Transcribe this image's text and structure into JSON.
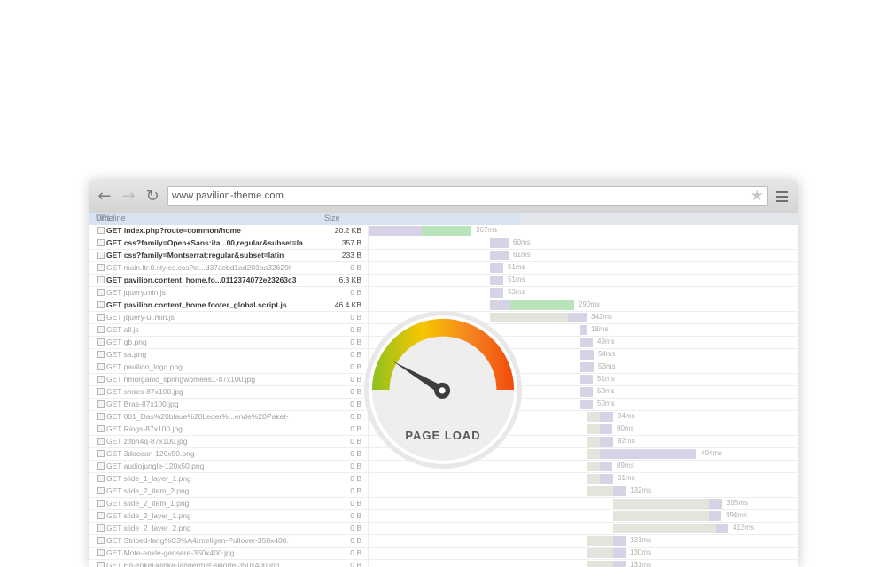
{
  "browser": {
    "url": "www.pavilion-theme.com",
    "back_icon": "back-arrow-icon",
    "forward_icon": "forward-arrow-icon",
    "reload_icon": "reload-icon",
    "bookmark_icon": "star-icon",
    "menu_icon": "hamburger-menu-icon"
  },
  "columns": {
    "url": "URL",
    "size": "Size",
    "timeline": "Timeline"
  },
  "colors": {
    "wait": "#d7d3e6",
    "receive": "#b9e3b9",
    "blocked": "#e4e3dc"
  },
  "requests": [
    {
      "url": "GET index.php?route=common/home",
      "size": "20.2 KB",
      "bold": true,
      "time": "367ms",
      "segs": [
        [
          0,
          60,
          "wait"
        ],
        [
          60,
          116,
          "receive"
        ]
      ]
    },
    {
      "url": "GET css?family=Open+Sans:ita...00,regular&subset=la",
      "size": "357 B",
      "bold": true,
      "time": "60ms",
      "segs": [
        [
          137,
          158,
          "wait"
        ]
      ]
    },
    {
      "url": "GET css?family=Montserrat:regular&subset=latin",
      "size": "233 B",
      "bold": true,
      "time": "61ms",
      "segs": [
        [
          137,
          158,
          "wait"
        ]
      ]
    },
    {
      "url": "GET main.ltr.0.styles.css?id...d37acbd1ad203aa32629l",
      "size": "0 B",
      "bold": false,
      "time": "51ms",
      "segs": [
        [
          137,
          152,
          "wait"
        ]
      ]
    },
    {
      "url": "GET pavilion.content_home.fo...0112374072e23263c3",
      "size": "6.3 KB",
      "bold": true,
      "time": "51ms",
      "segs": [
        [
          137,
          152,
          "wait"
        ]
      ]
    },
    {
      "url": "GET jquery.min.js",
      "size": "0 B",
      "bold": false,
      "time": "53ms",
      "segs": [
        [
          137,
          152,
          "wait"
        ]
      ]
    },
    {
      "url": "GET pavilion.content_home.footer_global.script.js",
      "size": "46.4 KB",
      "bold": true,
      "time": "290ms",
      "segs": [
        [
          137,
          160,
          "wait"
        ],
        [
          160,
          232,
          "receive"
        ]
      ]
    },
    {
      "url": "GET jquery-ui.min.js",
      "size": "0 B",
      "bold": false,
      "time": "342ms",
      "segs": [
        [
          137,
          225,
          "blocked"
        ],
        [
          225,
          246,
          "wait"
        ]
      ]
    },
    {
      "url": "GET all.js",
      "size": "0 B",
      "bold": false,
      "time": "18ms",
      "segs": [
        [
          239,
          246,
          "wait"
        ]
      ]
    },
    {
      "url": "GET gb.png",
      "size": "0 B",
      "bold": false,
      "time": "49ms",
      "segs": [
        [
          239,
          253,
          "wait"
        ]
      ]
    },
    {
      "url": "GET sa.png",
      "size": "0 B",
      "bold": false,
      "time": "54ms",
      "segs": [
        [
          239,
          254,
          "wait"
        ]
      ]
    },
    {
      "url": "GET pavilion_logo.png",
      "size": "0 B",
      "bold": false,
      "time": "53ms",
      "segs": [
        [
          239,
          254,
          "wait"
        ]
      ]
    },
    {
      "url": "GET hmorganic_springwomens1-87x100.jpg",
      "size": "0 B",
      "bold": false,
      "time": "51ms",
      "segs": [
        [
          239,
          253,
          "wait"
        ]
      ]
    },
    {
      "url": "GET shoes-87x100.jpg",
      "size": "0 B",
      "bold": false,
      "time": "50ms",
      "segs": [
        [
          239,
          253,
          "wait"
        ]
      ]
    },
    {
      "url": "GET Bras-87x100.jpg",
      "size": "0 B",
      "bold": false,
      "time": "50ms",
      "segs": [
        [
          239,
          253,
          "wait"
        ]
      ]
    },
    {
      "url": "GET 001_Das%20blaue%20Leder%...ende%20Paket-",
      "size": "0 B",
      "bold": false,
      "time": "94ms",
      "segs": [
        [
          246,
          261,
          "blocked"
        ],
        [
          261,
          276,
          "wait"
        ]
      ]
    },
    {
      "url": "GET Rings-87x100.jpg",
      "size": "0 B",
      "bold": false,
      "time": "90ms",
      "segs": [
        [
          246,
          261,
          "blocked"
        ],
        [
          261,
          275,
          "wait"
        ]
      ]
    },
    {
      "url": "GET zjfbh4q-87x100.jpg",
      "size": "0 B",
      "bold": false,
      "time": "92ms",
      "segs": [
        [
          246,
          261,
          "blocked"
        ],
        [
          261,
          276,
          "wait"
        ]
      ]
    },
    {
      "url": "GET 3docean-120x50.png",
      "size": "0 B",
      "bold": false,
      "time": "404ms",
      "segs": [
        [
          246,
          261,
          "blocked"
        ],
        [
          261,
          370,
          "wait"
        ]
      ]
    },
    {
      "url": "GET audiojungle-120x50.png",
      "size": "0 B",
      "bold": false,
      "time": "89ms",
      "segs": [
        [
          246,
          261,
          "blocked"
        ],
        [
          261,
          275,
          "wait"
        ]
      ]
    },
    {
      "url": "GET slide_1_layer_1.png",
      "size": "0 B",
      "bold": false,
      "time": "91ms",
      "segs": [
        [
          246,
          261,
          "blocked"
        ],
        [
          261,
          276,
          "wait"
        ]
      ]
    },
    {
      "url": "GET slide_2_item_2.png",
      "size": "0 B",
      "bold": false,
      "time": "132ms",
      "segs": [
        [
          246,
          276,
          "blocked"
        ],
        [
          276,
          290,
          "wait"
        ]
      ]
    },
    {
      "url": "GET slide_2_item_1.png",
      "size": "0 B",
      "bold": false,
      "time": "395ms",
      "segs": [
        [
          276,
          384,
          "blocked"
        ],
        [
          384,
          399,
          "wait"
        ]
      ]
    },
    {
      "url": "GET slide_2_layer_1.png",
      "size": "0 B",
      "bold": false,
      "time": "394ms",
      "segs": [
        [
          276,
          384,
          "blocked"
        ],
        [
          384,
          398,
          "wait"
        ]
      ]
    },
    {
      "url": "GET slide_2_layer_2.png",
      "size": "0 B",
      "bold": false,
      "time": "412ms",
      "segs": [
        [
          276,
          392,
          "blocked"
        ],
        [
          392,
          406,
          "wait"
        ]
      ]
    },
    {
      "url": "GET Striped-lang%C3%A4rmeligen-Pullover-350x400.",
      "size": "0 B",
      "bold": false,
      "time": "131ms",
      "segs": [
        [
          246,
          276,
          "blocked"
        ],
        [
          276,
          290,
          "wait"
        ]
      ]
    },
    {
      "url": "GET Mote-enkle-gensere-350x400.jpg",
      "size": "0 B",
      "bold": false,
      "time": "130ms",
      "segs": [
        [
          246,
          276,
          "blocked"
        ],
        [
          276,
          290,
          "wait"
        ]
      ]
    },
    {
      "url": "GET En-enkel-klinke-langermet-skjorte-350x400.jpg",
      "size": "0 B",
      "bold": false,
      "time": "131ms",
      "segs": [
        [
          246,
          276,
          "blocked"
        ],
        [
          276,
          290,
          "wait"
        ]
      ]
    }
  ],
  "gauge": {
    "label": "PAGE LOAD",
    "icon": "speedometer-icon",
    "arc_colors": [
      "#8dc21f",
      "#f7c600",
      "#f58220",
      "#f24a0c"
    ]
  }
}
